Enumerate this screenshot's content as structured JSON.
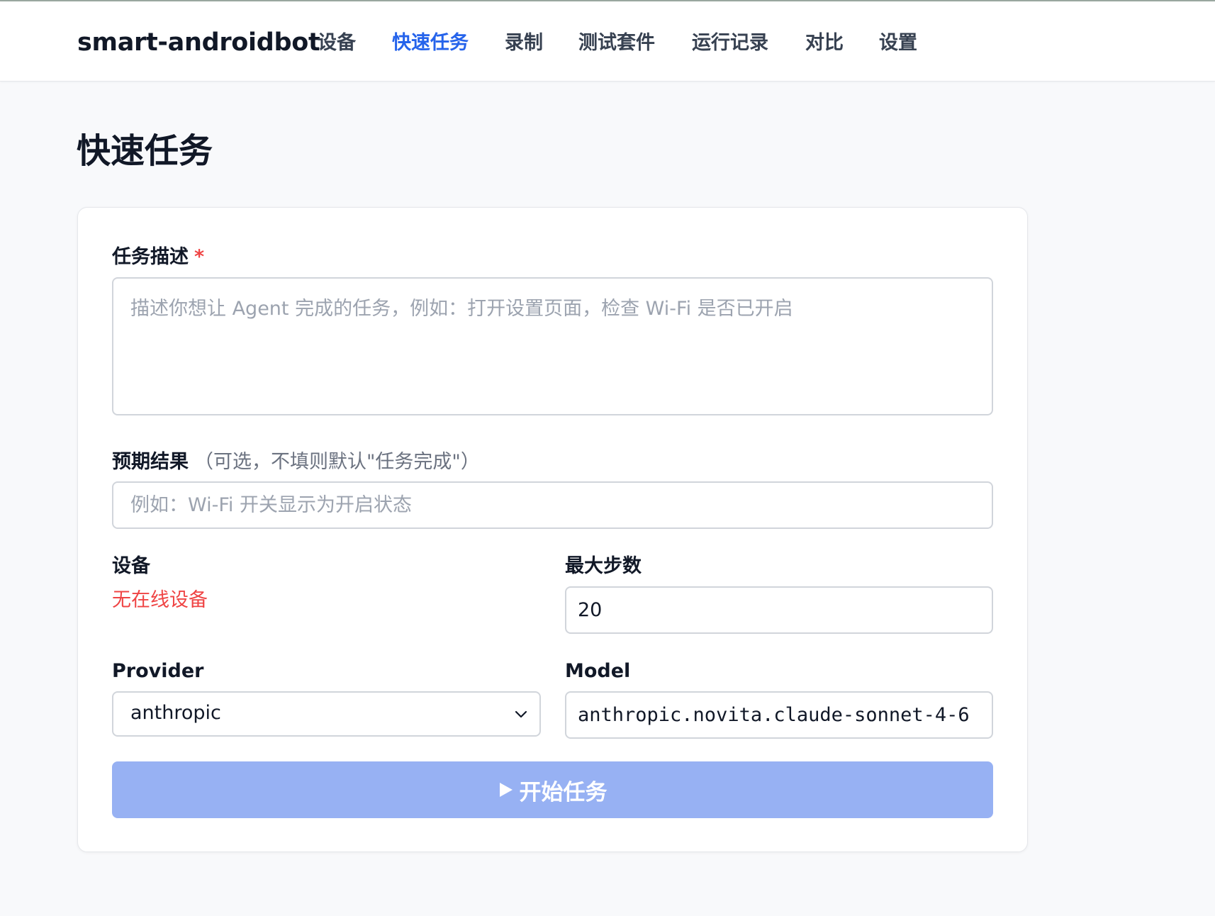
{
  "nav": {
    "brand": "smart-androidbot",
    "items": [
      {
        "label": "设备"
      },
      {
        "label": "快速任务",
        "active": true
      },
      {
        "label": "录制"
      },
      {
        "label": "测试套件"
      },
      {
        "label": "运行记录"
      },
      {
        "label": "对比"
      },
      {
        "label": "设置"
      }
    ]
  },
  "page": {
    "title": "快速任务"
  },
  "form": {
    "task": {
      "label": "任务描述",
      "required_mark": "*",
      "placeholder": "描述你想让 Agent 完成的任务，例如：打开设置页面，检查 Wi-Fi 是否已开启",
      "value": ""
    },
    "expected": {
      "label": "预期结果",
      "hint": "（可选，不填则默认\"任务完成\"）",
      "placeholder": "例如：Wi-Fi 开关显示为开启状态",
      "value": ""
    },
    "device": {
      "label": "设备",
      "status": "无在线设备"
    },
    "max_steps": {
      "label": "最大步数",
      "value": "20"
    },
    "provider": {
      "label": "Provider",
      "value": "anthropic"
    },
    "model": {
      "label": "Model",
      "value": "anthropic.novita.claude-sonnet-4-6"
    },
    "submit": {
      "icon": "play-icon",
      "label": "开始任务"
    }
  },
  "colors": {
    "accent": "#2563eb",
    "error": "#ef4444",
    "button_disabled": "#97b1f3"
  }
}
